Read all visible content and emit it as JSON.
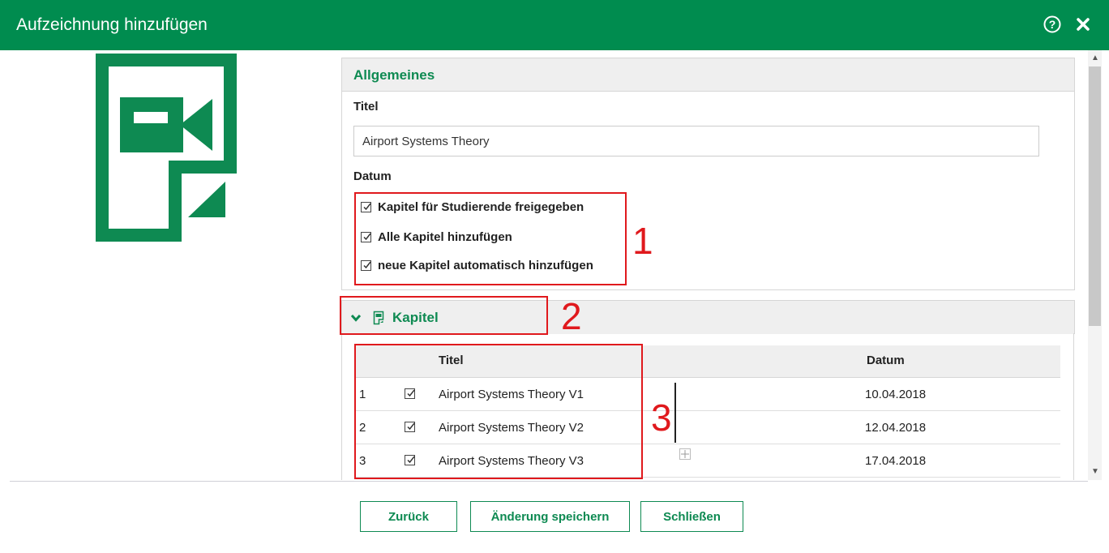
{
  "window": {
    "title": "Aufzeichnung hinzufügen"
  },
  "colors": {
    "brand": "#008c4f",
    "accent_text": "#0e8a52",
    "annotation_red": "#e0191d"
  },
  "icons": [
    "help-icon",
    "close-icon",
    "video-document-icon",
    "chevron-down-icon",
    "chapter-icon",
    "resize-handle-icon"
  ],
  "general": {
    "header": "Allgemeines",
    "title_label": "Titel",
    "title_value": "Airport Systems Theory",
    "date_label": "Datum",
    "options": [
      {
        "label": "Kapitel für Studierende freigegeben",
        "checked": true
      },
      {
        "label": "Alle Kapitel hinzufügen",
        "checked": true
      },
      {
        "label": "neue Kapitel automatisch hinzufügen",
        "checked": true
      }
    ]
  },
  "chapters": {
    "header": "Kapitel",
    "columns": {
      "title": "Titel",
      "date": "Datum"
    },
    "rows": [
      {
        "num": "1",
        "checked": true,
        "title": "Airport Systems Theory V1",
        "date": "10.04.2018"
      },
      {
        "num": "2",
        "checked": true,
        "title": "Airport Systems Theory V2",
        "date": "12.04.2018"
      },
      {
        "num": "3",
        "checked": true,
        "title": "Airport Systems Theory V3",
        "date": "17.04.2018"
      }
    ]
  },
  "annotations": [
    "1",
    "2",
    "3"
  ],
  "buttons": {
    "back": "Zurück",
    "save": "Änderung speichern",
    "close": "Schließen"
  }
}
